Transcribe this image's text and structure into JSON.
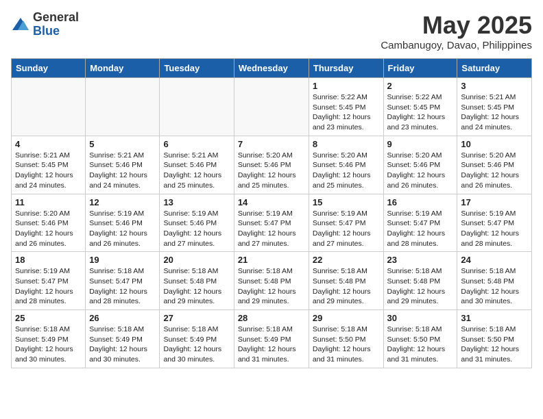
{
  "header": {
    "logo_general": "General",
    "logo_blue": "Blue",
    "month_title": "May 2025",
    "location": "Cambanugoy, Davao, Philippines"
  },
  "days_of_week": [
    "Sunday",
    "Monday",
    "Tuesday",
    "Wednesday",
    "Thursday",
    "Friday",
    "Saturday"
  ],
  "weeks": [
    [
      {
        "day": "",
        "info": ""
      },
      {
        "day": "",
        "info": ""
      },
      {
        "day": "",
        "info": ""
      },
      {
        "day": "",
        "info": ""
      },
      {
        "day": "1",
        "info": "Sunrise: 5:22 AM\nSunset: 5:45 PM\nDaylight: 12 hours\nand 23 minutes."
      },
      {
        "day": "2",
        "info": "Sunrise: 5:22 AM\nSunset: 5:45 PM\nDaylight: 12 hours\nand 23 minutes."
      },
      {
        "day": "3",
        "info": "Sunrise: 5:21 AM\nSunset: 5:45 PM\nDaylight: 12 hours\nand 24 minutes."
      }
    ],
    [
      {
        "day": "4",
        "info": "Sunrise: 5:21 AM\nSunset: 5:45 PM\nDaylight: 12 hours\nand 24 minutes."
      },
      {
        "day": "5",
        "info": "Sunrise: 5:21 AM\nSunset: 5:46 PM\nDaylight: 12 hours\nand 24 minutes."
      },
      {
        "day": "6",
        "info": "Sunrise: 5:21 AM\nSunset: 5:46 PM\nDaylight: 12 hours\nand 25 minutes."
      },
      {
        "day": "7",
        "info": "Sunrise: 5:20 AM\nSunset: 5:46 PM\nDaylight: 12 hours\nand 25 minutes."
      },
      {
        "day": "8",
        "info": "Sunrise: 5:20 AM\nSunset: 5:46 PM\nDaylight: 12 hours\nand 25 minutes."
      },
      {
        "day": "9",
        "info": "Sunrise: 5:20 AM\nSunset: 5:46 PM\nDaylight: 12 hours\nand 26 minutes."
      },
      {
        "day": "10",
        "info": "Sunrise: 5:20 AM\nSunset: 5:46 PM\nDaylight: 12 hours\nand 26 minutes."
      }
    ],
    [
      {
        "day": "11",
        "info": "Sunrise: 5:20 AM\nSunset: 5:46 PM\nDaylight: 12 hours\nand 26 minutes."
      },
      {
        "day": "12",
        "info": "Sunrise: 5:19 AM\nSunset: 5:46 PM\nDaylight: 12 hours\nand 26 minutes."
      },
      {
        "day": "13",
        "info": "Sunrise: 5:19 AM\nSunset: 5:46 PM\nDaylight: 12 hours\nand 27 minutes."
      },
      {
        "day": "14",
        "info": "Sunrise: 5:19 AM\nSunset: 5:47 PM\nDaylight: 12 hours\nand 27 minutes."
      },
      {
        "day": "15",
        "info": "Sunrise: 5:19 AM\nSunset: 5:47 PM\nDaylight: 12 hours\nand 27 minutes."
      },
      {
        "day": "16",
        "info": "Sunrise: 5:19 AM\nSunset: 5:47 PM\nDaylight: 12 hours\nand 28 minutes."
      },
      {
        "day": "17",
        "info": "Sunrise: 5:19 AM\nSunset: 5:47 PM\nDaylight: 12 hours\nand 28 minutes."
      }
    ],
    [
      {
        "day": "18",
        "info": "Sunrise: 5:19 AM\nSunset: 5:47 PM\nDaylight: 12 hours\nand 28 minutes."
      },
      {
        "day": "19",
        "info": "Sunrise: 5:18 AM\nSunset: 5:47 PM\nDaylight: 12 hours\nand 28 minutes."
      },
      {
        "day": "20",
        "info": "Sunrise: 5:18 AM\nSunset: 5:48 PM\nDaylight: 12 hours\nand 29 minutes."
      },
      {
        "day": "21",
        "info": "Sunrise: 5:18 AM\nSunset: 5:48 PM\nDaylight: 12 hours\nand 29 minutes."
      },
      {
        "day": "22",
        "info": "Sunrise: 5:18 AM\nSunset: 5:48 PM\nDaylight: 12 hours\nand 29 minutes."
      },
      {
        "day": "23",
        "info": "Sunrise: 5:18 AM\nSunset: 5:48 PM\nDaylight: 12 hours\nand 29 minutes."
      },
      {
        "day": "24",
        "info": "Sunrise: 5:18 AM\nSunset: 5:48 PM\nDaylight: 12 hours\nand 30 minutes."
      }
    ],
    [
      {
        "day": "25",
        "info": "Sunrise: 5:18 AM\nSunset: 5:49 PM\nDaylight: 12 hours\nand 30 minutes."
      },
      {
        "day": "26",
        "info": "Sunrise: 5:18 AM\nSunset: 5:49 PM\nDaylight: 12 hours\nand 30 minutes."
      },
      {
        "day": "27",
        "info": "Sunrise: 5:18 AM\nSunset: 5:49 PM\nDaylight: 12 hours\nand 30 minutes."
      },
      {
        "day": "28",
        "info": "Sunrise: 5:18 AM\nSunset: 5:49 PM\nDaylight: 12 hours\nand 31 minutes."
      },
      {
        "day": "29",
        "info": "Sunrise: 5:18 AM\nSunset: 5:50 PM\nDaylight: 12 hours\nand 31 minutes."
      },
      {
        "day": "30",
        "info": "Sunrise: 5:18 AM\nSunset: 5:50 PM\nDaylight: 12 hours\nand 31 minutes."
      },
      {
        "day": "31",
        "info": "Sunrise: 5:18 AM\nSunset: 5:50 PM\nDaylight: 12 hours\nand 31 minutes."
      }
    ]
  ]
}
